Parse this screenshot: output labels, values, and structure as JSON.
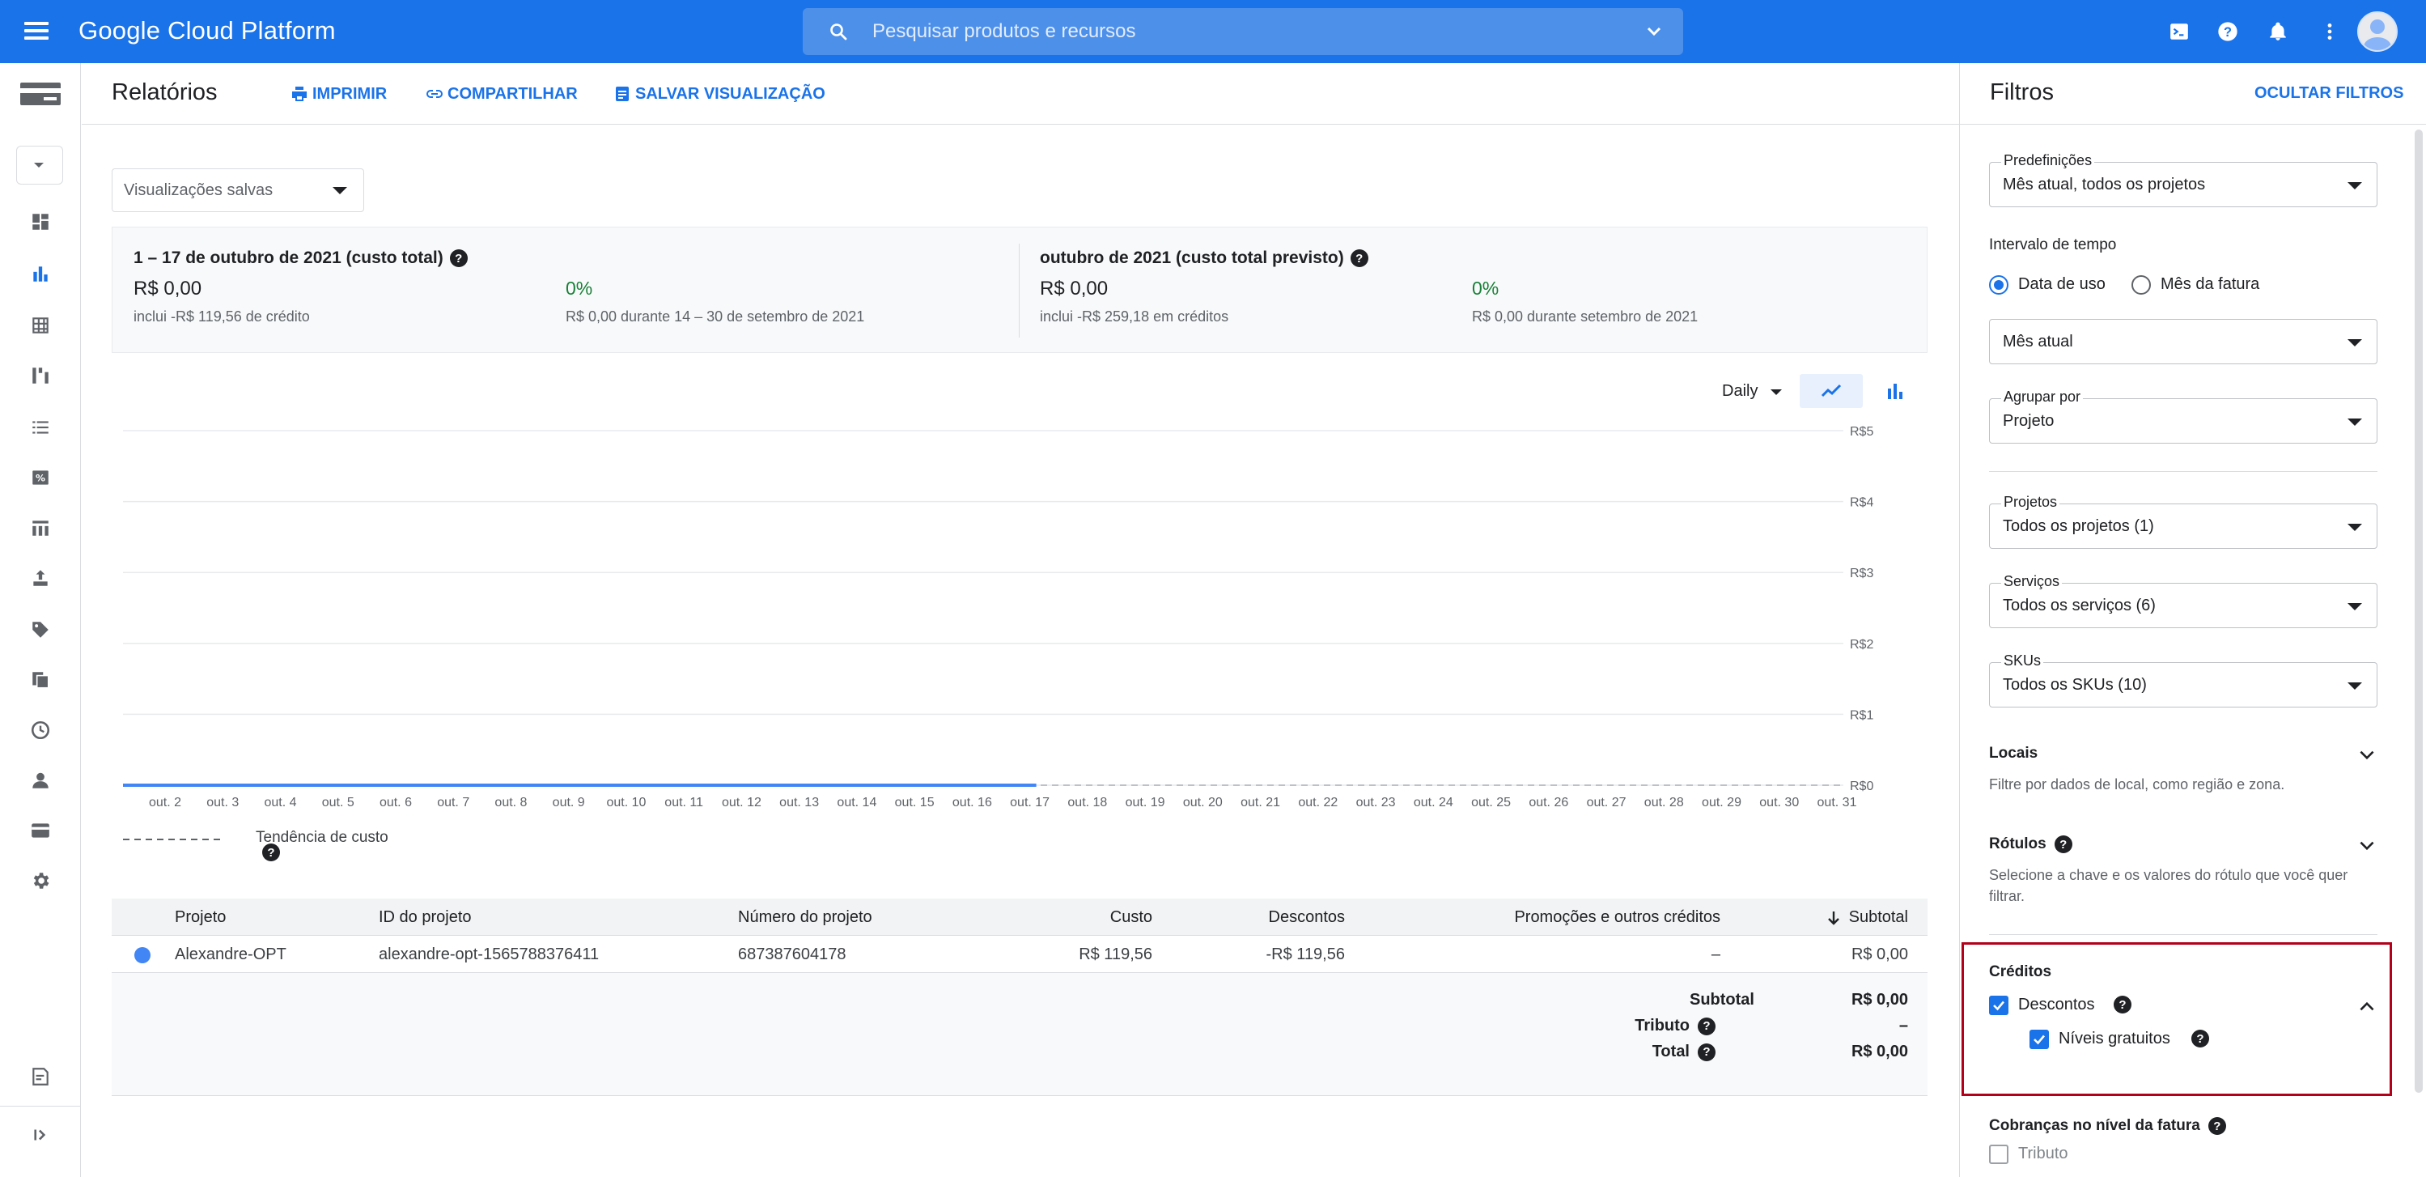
{
  "topbar": {
    "title": "Google Cloud Platform",
    "search_placeholder": "Pesquisar produtos e recursos",
    "icons": [
      "menu-icon",
      "search-icon",
      "chevron-down-icon",
      "cloud-shell-icon",
      "help-icon",
      "bell-icon",
      "more-vert-icon",
      "avatar"
    ],
    "bg_color": "#1a73e8"
  },
  "header": {
    "title": "Relatórios",
    "print_label": "IMPRIMIR",
    "share_label": "COMPARTILHAR",
    "save_view_label": "SALVAR VISUALIZAÇÃO"
  },
  "saved_views": {
    "placeholder": "Visualizações salvas"
  },
  "summary": {
    "left": {
      "title": "1 – 17 de outubro de 2021 (custo total)",
      "value": "R$ 0,00",
      "note": "inclui -R$ 119,56 de crédito",
      "pct": "0%",
      "comparison": "R$ 0,00 durante 14 – 30 de setembro de 2021"
    },
    "right": {
      "title": "outubro de 2021 (custo total previsto)",
      "value": "R$ 0,00",
      "note": "inclui -R$ 259,18 em créditos",
      "pct": "0%",
      "comparison": "R$ 0,00 durante setembro de 2021"
    }
  },
  "chart_controls": {
    "granularity": "Daily"
  },
  "chart_data": {
    "type": "line",
    "title": "",
    "xlabel": "",
    "ylabel": "",
    "y_ticks": [
      "R$5",
      "R$4",
      "R$3",
      "R$2",
      "R$1",
      "R$0"
    ],
    "ylim": [
      0,
      5
    ],
    "categories": [
      "out. 2",
      "out. 3",
      "out. 4",
      "out. 5",
      "out. 6",
      "out. 7",
      "out. 8",
      "out. 9",
      "out. 10",
      "out. 11",
      "out. 12",
      "out. 13",
      "out. 14",
      "out. 15",
      "out. 16",
      "out. 17",
      "out. 18",
      "out. 19",
      "out. 20",
      "out. 21",
      "out. 22",
      "out. 23",
      "out. 24",
      "out. 25",
      "out. 26",
      "out. 27",
      "out. 28",
      "out. 29",
      "out. 30",
      "out. 31"
    ],
    "series": [
      {
        "values": [
          0,
          0,
          0,
          0,
          0,
          0,
          0,
          0,
          0,
          0,
          0,
          0,
          0,
          0,
          0,
          0
        ],
        "color": "#4285f4"
      }
    ],
    "trend_label": "Tendência de custo",
    "grid": true
  },
  "table": {
    "columns": [
      "Projeto",
      "ID do projeto",
      "Número do projeto",
      "Custo",
      "Descontos",
      "Promoções e outros créditos",
      "Subtotal"
    ],
    "rows": [
      [
        "Alexandre-OPT",
        "alexandre-opt-1565788376411",
        "687387604178",
        "R$ 119,56",
        "-R$ 119,56",
        "–",
        "R$ 0,00"
      ]
    ],
    "row_color": "#4285f4",
    "totals": {
      "subtotal_label": "Subtotal",
      "subtotal_value": "R$ 0,00",
      "tax_label": "Tributo",
      "tax_value": "–",
      "total_label": "Total",
      "total_value": "R$ 0,00"
    }
  },
  "filters": {
    "title": "Filtros",
    "hide_label": "OCULTAR FILTROS",
    "presets": {
      "label": "Predefinições",
      "value": "Mês atual, todos os projetos"
    },
    "time_range": {
      "label": "Intervalo de tempo",
      "option_usage": "Data de uso",
      "option_invoice": "Mês da fatura",
      "selected": "Data de uso",
      "period_value": "Mês atual"
    },
    "group_by": {
      "label": "Agrupar por",
      "value": "Projeto"
    },
    "projects": {
      "label": "Projetos",
      "value": "Todos os projetos (1)"
    },
    "services": {
      "label": "Serviços",
      "value": "Todos os serviços (6)"
    },
    "skus": {
      "label": "SKUs",
      "value": "Todos os SKUs (10)"
    },
    "locations": {
      "label": "Locais",
      "desc": "Filtre por dados de local, como região e zona."
    },
    "labels": {
      "label": "Rótulos",
      "desc": "Selecione a chave e os valores do rótulo que você quer filtrar."
    },
    "credits": {
      "label": "Créditos",
      "discounts": "Descontos",
      "discounts_checked": true,
      "free_tiers": "Níveis gratuitos",
      "free_tiers_checked": true
    },
    "invoice_charges": {
      "label": "Cobranças no nível da fatura",
      "tax": "Tributo",
      "tax_checked": false
    }
  }
}
